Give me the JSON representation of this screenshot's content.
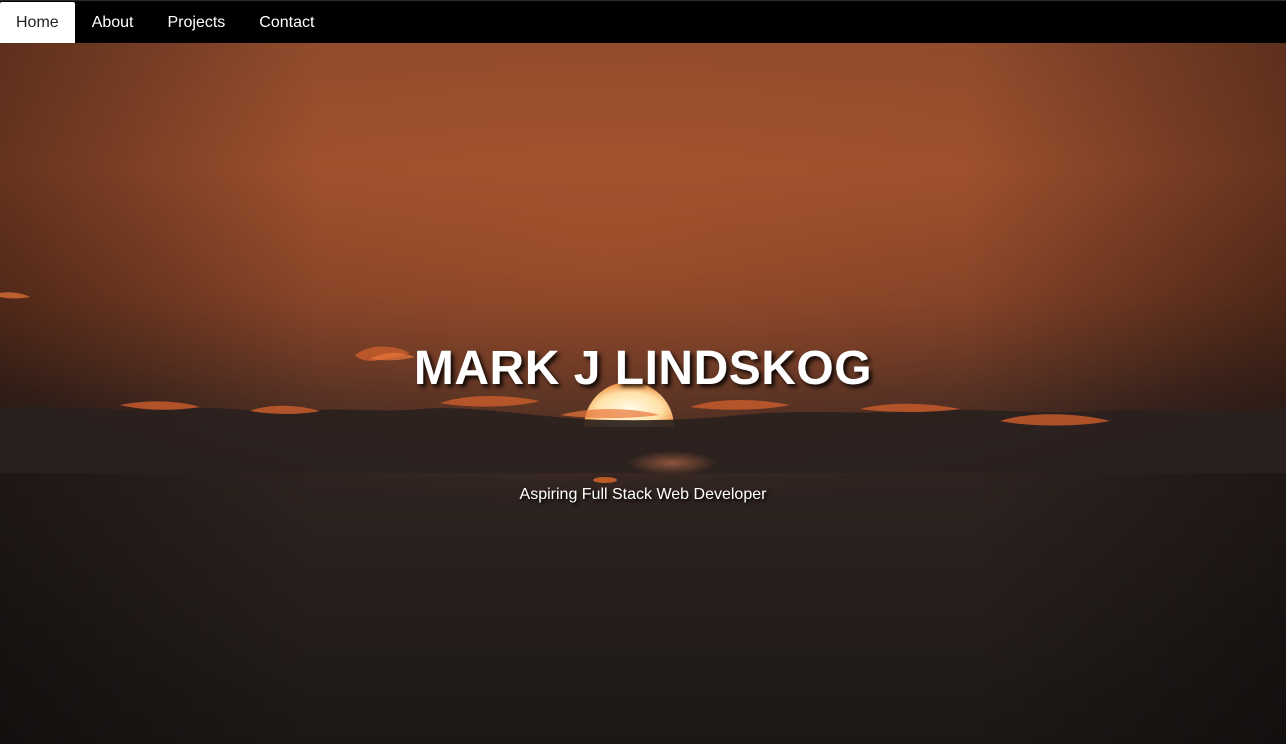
{
  "nav": {
    "items": [
      {
        "label": "Home",
        "active": true
      },
      {
        "label": "About",
        "active": false
      },
      {
        "label": "Projects",
        "active": false
      },
      {
        "label": "Contact",
        "active": false
      }
    ]
  },
  "hero": {
    "title": "MARK J LINDSKOG",
    "subtitle": "Aspiring Full Stack Web Developer",
    "background": "sunset-clouds-photo"
  },
  "colors": {
    "nav_background": "#000000",
    "nav_active_background": "#ffffff",
    "sky_top": "#9a4f2e",
    "sky_bottom": "#1e1a18",
    "sun": "#fff3d6"
  }
}
